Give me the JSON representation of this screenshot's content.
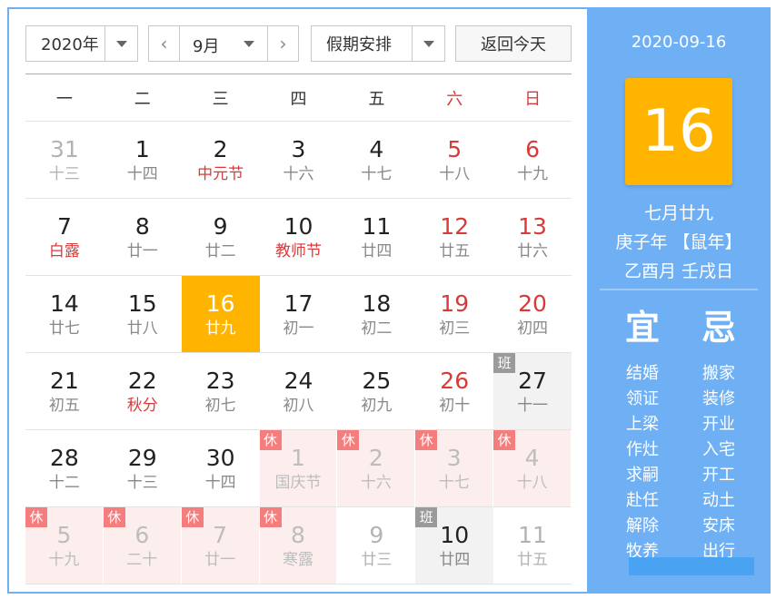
{
  "toolbar": {
    "year": "2020年",
    "month": "9月",
    "prev_glyph": "‹",
    "next_glyph": "›",
    "holiday": "假期安排",
    "today": "返回今天"
  },
  "weekdays": [
    "一",
    "二",
    "三",
    "四",
    "五",
    "六",
    "日"
  ],
  "days": [
    {
      "d": "31",
      "l": "十三",
      "cls": "other"
    },
    {
      "d": "1",
      "l": "十四",
      "cls": ""
    },
    {
      "d": "2",
      "l": "中元节",
      "cls": "fest"
    },
    {
      "d": "3",
      "l": "十六",
      "cls": ""
    },
    {
      "d": "4",
      "l": "十七",
      "cls": ""
    },
    {
      "d": "5",
      "l": "十八",
      "cls": "weekend"
    },
    {
      "d": "6",
      "l": "十九",
      "cls": "weekend"
    },
    {
      "d": "7",
      "l": "白露",
      "cls": "fest"
    },
    {
      "d": "8",
      "l": "廿一",
      "cls": ""
    },
    {
      "d": "9",
      "l": "廿二",
      "cls": ""
    },
    {
      "d": "10",
      "l": "教师节",
      "cls": "fest"
    },
    {
      "d": "11",
      "l": "廿四",
      "cls": ""
    },
    {
      "d": "12",
      "l": "廿五",
      "cls": "weekend"
    },
    {
      "d": "13",
      "l": "廿六",
      "cls": "weekend"
    },
    {
      "d": "14",
      "l": "廿七",
      "cls": ""
    },
    {
      "d": "15",
      "l": "廿八",
      "cls": ""
    },
    {
      "d": "16",
      "l": "廿九",
      "cls": "selected"
    },
    {
      "d": "17",
      "l": "初一",
      "cls": ""
    },
    {
      "d": "18",
      "l": "初二",
      "cls": ""
    },
    {
      "d": "19",
      "l": "初三",
      "cls": "weekend"
    },
    {
      "d": "20",
      "l": "初四",
      "cls": "weekend"
    },
    {
      "d": "21",
      "l": "初五",
      "cls": ""
    },
    {
      "d": "22",
      "l": "秋分",
      "cls": "fest"
    },
    {
      "d": "23",
      "l": "初七",
      "cls": ""
    },
    {
      "d": "24",
      "l": "初八",
      "cls": ""
    },
    {
      "d": "25",
      "l": "初九",
      "cls": ""
    },
    {
      "d": "26",
      "l": "初十",
      "cls": "weekend"
    },
    {
      "d": "27",
      "l": "十一",
      "cls": "work",
      "badge": "班"
    },
    {
      "d": "28",
      "l": "十二",
      "cls": ""
    },
    {
      "d": "29",
      "l": "十三",
      "cls": ""
    },
    {
      "d": "30",
      "l": "十四",
      "cls": ""
    },
    {
      "d": "1",
      "l": "国庆节",
      "cls": "rest",
      "badge": "休"
    },
    {
      "d": "2",
      "l": "十六",
      "cls": "rest",
      "badge": "休"
    },
    {
      "d": "3",
      "l": "十七",
      "cls": "rest",
      "badge": "休"
    },
    {
      "d": "4",
      "l": "十八",
      "cls": "rest",
      "badge": "休"
    },
    {
      "d": "5",
      "l": "十九",
      "cls": "rest",
      "badge": "休"
    },
    {
      "d": "6",
      "l": "二十",
      "cls": "rest",
      "badge": "休"
    },
    {
      "d": "7",
      "l": "廿一",
      "cls": "rest",
      "badge": "休"
    },
    {
      "d": "8",
      "l": "寒露",
      "cls": "rest",
      "badge": "休"
    },
    {
      "d": "9",
      "l": "廿三",
      "cls": "other"
    },
    {
      "d": "10",
      "l": "廿四",
      "cls": "work",
      "badge": "班"
    },
    {
      "d": "11",
      "l": "廿五",
      "cls": "other"
    }
  ],
  "side": {
    "date": "2020-09-16",
    "big_day": "16",
    "lunar": "七月廿九",
    "year_ganzhi": "庚子年 【鼠年】",
    "month_day_ganzhi": "乙酉月 壬戌日",
    "yi_label": "宜",
    "ji_label": "忌",
    "yi": [
      "结婚",
      "领证",
      "上梁",
      "作灶",
      "求嗣",
      "赴任",
      "解除",
      "牧养"
    ],
    "ji": [
      "搬家",
      "装修",
      "开业",
      "入宅",
      "开工",
      "动土",
      "安床",
      "出行"
    ]
  },
  "colors": {
    "accent": "#6fb0f5",
    "selected": "#ffb400",
    "weekend": "#d83a3a",
    "rest_bg": "#fdeeee"
  }
}
